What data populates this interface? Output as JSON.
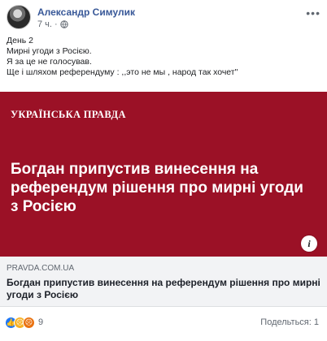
{
  "post": {
    "author": "Александр Симулик",
    "time": "7 ч.",
    "lines": [
      "День 2",
      "Мирні угоди з Росією.",
      "Я за це не голосував.",
      "Ще і шляхом референдуму : ,,это не мы , народ так хочет\""
    ]
  },
  "card": {
    "brand": "УКРАЇНСЬКА ПРАВДА",
    "headline": "Богдан припустив винесення на референдум рішення про мирні угоди з Росією",
    "domain": "PRAVDA.COM.UA",
    "title": "Богдан припустив винесення на референдум рішення про мирні угоди з Росією",
    "image_color": "#9b1126"
  },
  "footer": {
    "reactions_count": "9",
    "comments": "Подельться: 1"
  },
  "colors": {
    "link": "#385898",
    "muted": "#606770"
  }
}
